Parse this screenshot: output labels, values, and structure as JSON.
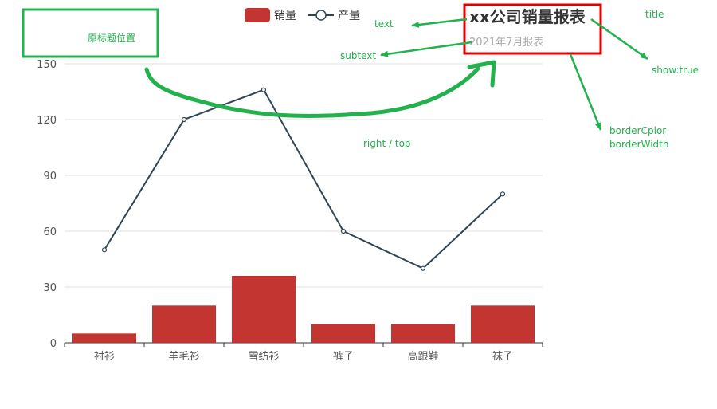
{
  "chart_data": {
    "type": "bar",
    "title": "xx公司销量报表",
    "subtitle": "2021年7月报表",
    "categories": [
      "衬衫",
      "羊毛衫",
      "雪纺衫",
      "裤子",
      "高跟鞋",
      "袜子"
    ],
    "series": [
      {
        "name": "销量",
        "type": "bar",
        "values": [
          5,
          20,
          36,
          10,
          10,
          20
        ],
        "color": "#c23531"
      },
      {
        "name": "产量",
        "type": "line",
        "values": [
          50,
          120,
          136,
          60,
          40,
          80
        ],
        "color": "#2f4554"
      }
    ],
    "ylim": [
      0,
      150
    ],
    "yticks": [
      0,
      30,
      60,
      90,
      120,
      150
    ],
    "grid": true,
    "legend_position": "top"
  },
  "annotations": {
    "original_title_position": "原标题位置",
    "text": "text",
    "subtext": "subtext",
    "title": "title",
    "show_true": "show:true",
    "right_top": "right  / top",
    "border_color": "borderCplor",
    "border_width": "borderWidth"
  },
  "colors": {
    "annotation": "#22b14c",
    "title_box_border": "#e00000",
    "axis": "#333333",
    "grid": "#e0e0e0"
  }
}
